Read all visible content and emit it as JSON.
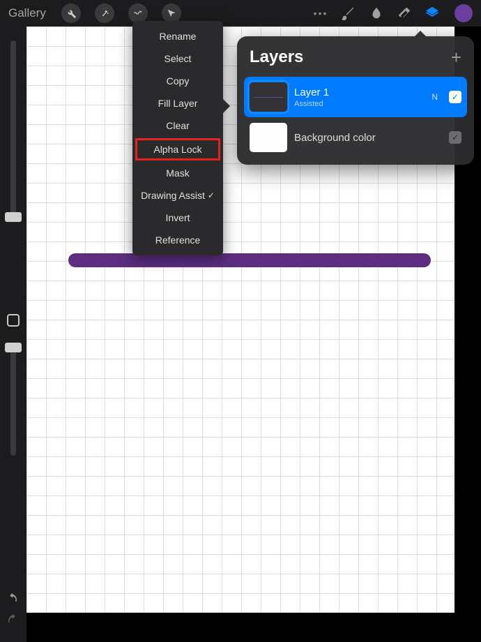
{
  "toolbar": {
    "gallery_label": "Gallery"
  },
  "context_menu": {
    "items": [
      {
        "label": "Rename",
        "checked": false,
        "highlight": false
      },
      {
        "label": "Select",
        "checked": false,
        "highlight": false
      },
      {
        "label": "Copy",
        "checked": false,
        "highlight": false
      },
      {
        "label": "Fill Layer",
        "checked": false,
        "highlight": false
      },
      {
        "label": "Clear",
        "checked": false,
        "highlight": false
      },
      {
        "label": "Alpha Lock",
        "checked": false,
        "highlight": true
      },
      {
        "label": "Mask",
        "checked": false,
        "highlight": false
      },
      {
        "label": "Drawing Assist",
        "checked": true,
        "highlight": false
      },
      {
        "label": "Invert",
        "checked": false,
        "highlight": false
      },
      {
        "label": "Reference",
        "checked": false,
        "highlight": false
      }
    ]
  },
  "layers_panel": {
    "title": "Layers",
    "layers": [
      {
        "name": "Layer 1",
        "sub": "Assisted",
        "blend": "N",
        "selected": true,
        "bg": false
      },
      {
        "name": "Background color",
        "sub": "",
        "blend": "",
        "selected": false,
        "bg": true
      }
    ]
  },
  "colors": {
    "accent_purple": "#6a3fa0",
    "selected_blue": "#007aff",
    "highlight_red": "#e52321"
  }
}
